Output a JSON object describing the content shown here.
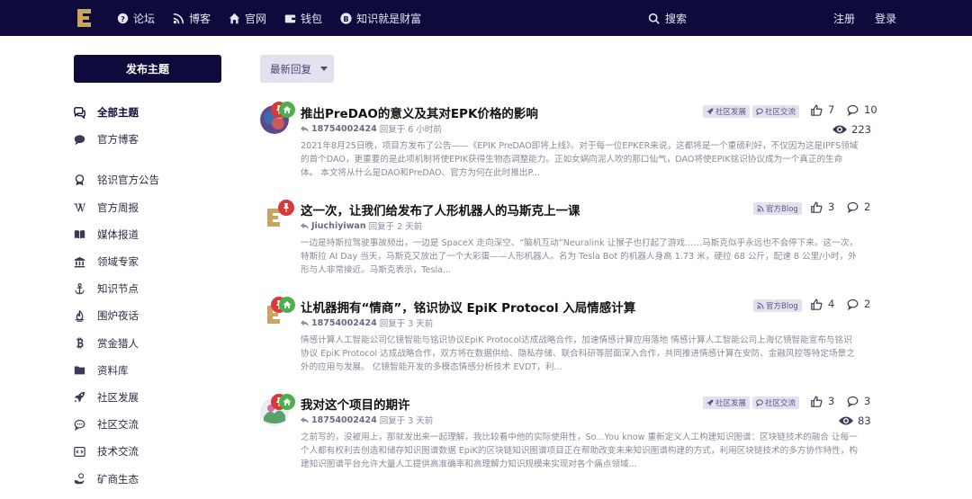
{
  "nav": {
    "items": [
      {
        "label": "论坛",
        "icon": "question-circle-icon"
      },
      {
        "label": "博客",
        "icon": "rss-icon"
      },
      {
        "label": "官网",
        "icon": "home-icon"
      },
      {
        "label": "钱包",
        "icon": "wallet-icon"
      },
      {
        "label": "知识就是财富",
        "icon": "bitcoin-icon"
      }
    ],
    "search_label": "搜索",
    "register_label": "注册",
    "login_label": "登录"
  },
  "start_button": "发布主题",
  "sort_label": "最新回复",
  "sidebar": {
    "items": [
      {
        "label": "全部主题",
        "icon": "comments-icon"
      },
      {
        "label": "官方博客",
        "icon": "comment-icon"
      },
      {
        "label": "铭识官方公告",
        "icon": "award-icon"
      },
      {
        "label": "官方周报",
        "icon": "wordpress-icon"
      },
      {
        "label": "媒体报道",
        "icon": "book-open-icon"
      },
      {
        "label": "领域专家",
        "icon": "university-icon"
      },
      {
        "label": "知识节点",
        "icon": "anchor-icon"
      },
      {
        "label": "围炉夜话",
        "icon": "fire-icon"
      },
      {
        "label": "赏金猎人",
        "icon": "bitcoin-icon"
      },
      {
        "label": "资料库",
        "icon": "folder-icon"
      },
      {
        "label": "社区发展",
        "icon": "rocket-icon"
      },
      {
        "label": "社区交流",
        "icon": "chat-icon"
      },
      {
        "label": "技术交流",
        "icon": "code-icon"
      },
      {
        "label": "矿商生态",
        "icon": "hand-coin-icon"
      }
    ]
  },
  "discussions": [
    {
      "title": "推出PreDAO的意义及其对EPK价格的影响",
      "user": "18754002424",
      "time": "回复于 6 小时前",
      "excerpt": "2021年8月25日晚，项目方发布了公告——《EPIK PreDAO即将上线》。对于每一位EPKER来说，这都将是一个重磅利好，不仅因为这是IPFS领域的首个DAO，更重要的是此项机制将使EPIK获得生物态调整能力。正如女娲向泥人吹的那口仙气，DAO将使EPIK铭识协议成为一个真正的生命体。 本文将从什么是DAO和PreDAO、官方为何在此时推出P...",
      "tags": [
        "社区发展",
        "社区交流"
      ],
      "likes": "7",
      "replies": "10",
      "views": "223"
    },
    {
      "title": "这一次，让我们给发布了人形机器人的马斯克上一课",
      "user": "Jiuchiyiwan",
      "time": "回复于 2 天前",
      "excerpt": "一边是特斯拉驾驶事故频出，一边是 SpaceX 走向深空、“脑机互动”Neuralink 让猴子也打起了游戏……马斯克似乎永远也不会停下来。这一次，特斯拉 AI Day 当天，马斯克又放出了一个大彩蛋——人形机器人。名为 Tesla Bot 的机器人身高 1.73 米，硬拉 68 公斤，配速 8 公里/小时，外形与人非常接近。马斯克表示，Tesla...",
      "tags": [
        "官方Blog"
      ],
      "likes": "3",
      "replies": "2",
      "views": ""
    },
    {
      "title": "让机器拥有“情商”，铭识协议 EpiK Protocol 入局情感计算",
      "user": "18754002424",
      "time": "回复于 3 天前",
      "excerpt": "情感计算人工智能公司亿镜智能与铭识协议EpiK Protocol达成战略合作，加速情感计算应用落地 情感计算人工智能公司上海亿镜智能宣布与铭识协议 EpiK Protocol 达成战略合作，双方将在数据供给、隐私存储、联合科研等层面深入合作，共同推进情感计算在安防、金融风控等特定场景之外的应用与发展。 亿镜智能开发的多模态情感分析技术 EVDT，利...",
      "tags": [
        "官方Blog"
      ],
      "likes": "4",
      "replies": "2",
      "views": ""
    },
    {
      "title": "我对这个项目的期许",
      "user": "18754002424",
      "time": "回复于 3 天前",
      "excerpt": "之前写的，没被用上，那就发出来一起理解，我比较看中他的实际使用性，So...You know 重新定义人工构建知识图谱：区块链技术的融合 让每一个人都有权利去创造和储存知识图谱数据 EpiK的区块链知识图谱项目正在帮助改变未来知识图谱构建的方式，利用区块链技术的多方协作特性，构建知识图谱平台允许大量人工提供高准确率和高理解力知识规模来实现对各个痛点领域...",
      "tags": [
        "社区发展",
        "社区交流"
      ],
      "likes": "3",
      "replies": "3",
      "views": "83"
    }
  ]
}
